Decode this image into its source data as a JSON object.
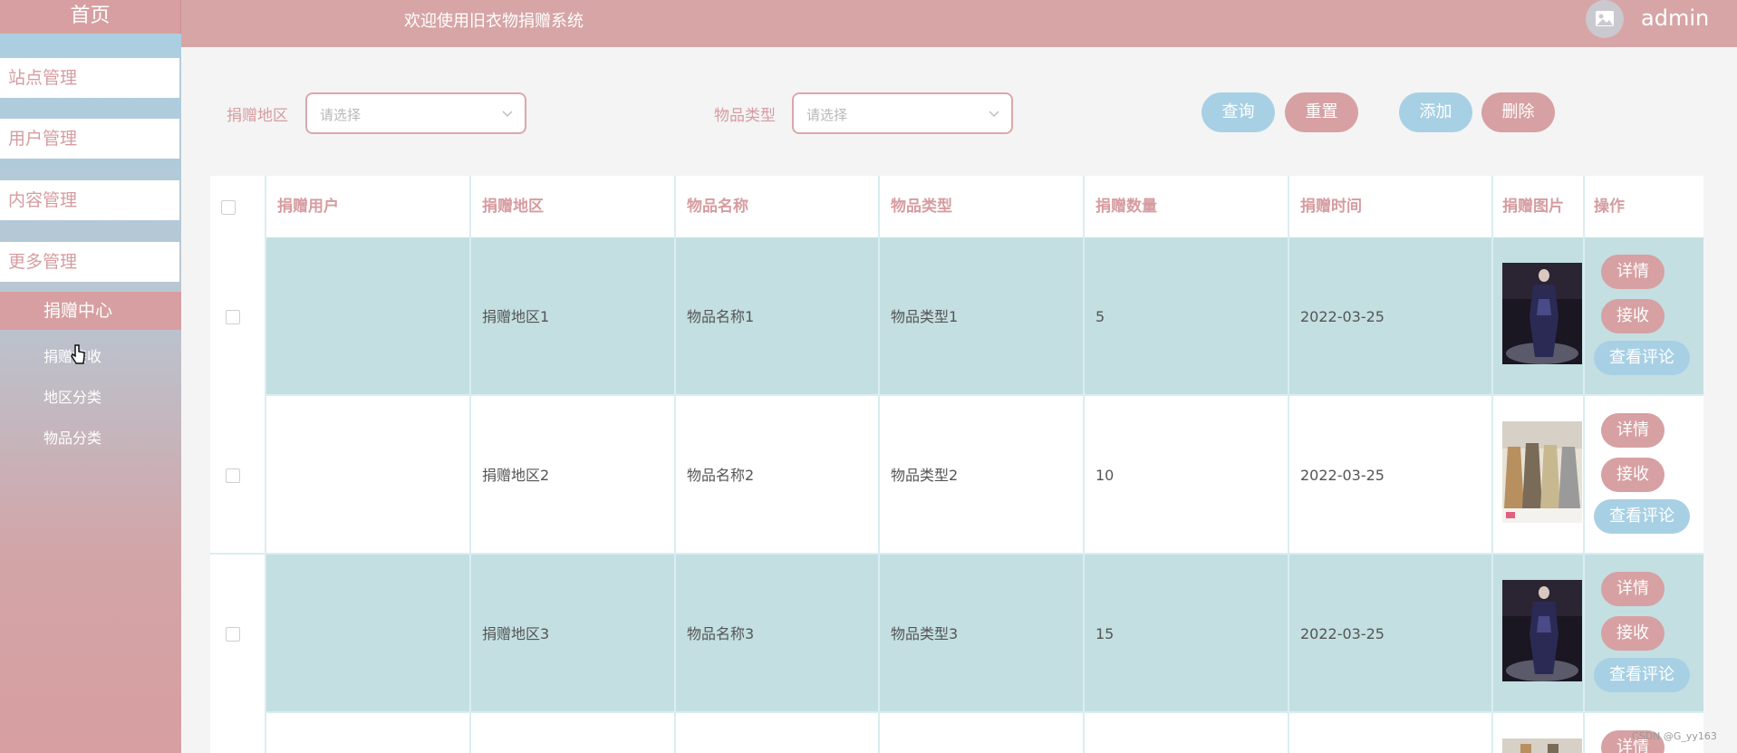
{
  "sidebar": {
    "home": "首页",
    "menus": [
      "站点管理",
      "用户管理",
      "内容管理",
      "更多管理"
    ],
    "active_menu": "捐赠中心",
    "sub_items": [
      "捐赠接收",
      "地区分类",
      "物品分类"
    ]
  },
  "header": {
    "welcome": "欢迎使用旧衣物捐赠系统",
    "user": "admin"
  },
  "search": {
    "region_label": "捐赠地区",
    "region_placeholder": "请选择",
    "type_label": "物品类型",
    "type_placeholder": "请选择",
    "query": "查询",
    "reset": "重置",
    "add": "添加",
    "delete": "删除"
  },
  "table": {
    "headers": [
      "捐赠用户",
      "捐赠地区",
      "物品名称",
      "物品类型",
      "捐赠数量",
      "捐赠时间",
      "捐赠图片",
      "操作"
    ],
    "rows": [
      {
        "user": "",
        "region": "捐赠地区1",
        "name": "物品名称1",
        "type": "物品类型1",
        "qty": "5",
        "date": "2022-03-25"
      },
      {
        "user": "",
        "region": "捐赠地区2",
        "name": "物品名称2",
        "type": "物品类型2",
        "qty": "10",
        "date": "2022-03-25"
      },
      {
        "user": "",
        "region": "捐赠地区3",
        "name": "物品名称3",
        "type": "物品类型3",
        "qty": "15",
        "date": "2022-03-25"
      }
    ],
    "actions": {
      "detail": "详情",
      "receive": "接收",
      "comments": "查看评论"
    }
  },
  "watermark": "CSDN @G_yy163",
  "colors": {
    "pink": "#d7a0a2",
    "blue": "#a8d0e4",
    "row_tint": "#c3dfe1"
  },
  "icons": {
    "avatar": "image-icon",
    "select": "chevron-down-icon"
  }
}
